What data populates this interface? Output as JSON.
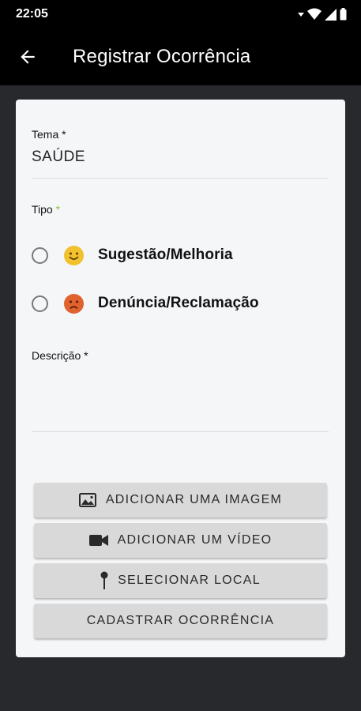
{
  "status_bar": {
    "time": "22:05",
    "icons": [
      "download-arrow-icon",
      "wifi-icon",
      "signal-icon",
      "battery-icon"
    ]
  },
  "app_bar": {
    "title": "Registrar Ocorrência",
    "back_icon": "arrow-back-icon"
  },
  "form": {
    "tema": {
      "label": "Tema",
      "required_mark": "*",
      "value": "SAÚDE"
    },
    "tipo": {
      "label": "Tipo",
      "required_mark": "*",
      "options": [
        {
          "label": "Sugestão/Melhoria",
          "icon": "smiley-happy-icon",
          "selected": false
        },
        {
          "label": "Denúncia/Reclamação",
          "icon": "smiley-sad-icon",
          "selected": false
        }
      ]
    },
    "descricao": {
      "label": "Descrição",
      "required_mark": "*",
      "value": ""
    }
  },
  "buttons": {
    "add_image": {
      "label": "ADICIONAR UMA IMAGEM",
      "icon": "image-icon"
    },
    "add_video": {
      "label": "ADICIONAR UM VÍDEO",
      "icon": "videocam-icon"
    },
    "select_location": {
      "label": "SELECIONAR LOCAL",
      "icon": "map-pin-icon"
    },
    "submit": {
      "label": "CADASTRAR OCORRÊNCIA"
    }
  },
  "colors": {
    "background": "#28292d",
    "bar": "#000000",
    "card": "#f5f6f8",
    "button": "#d9d9d9",
    "required_green": "#8bc34a",
    "happy_emoji": "#f2c12e",
    "sad_emoji": "#e0632f"
  }
}
